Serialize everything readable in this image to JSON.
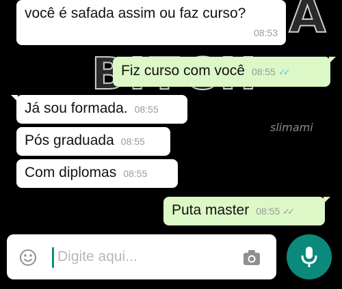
{
  "background": {
    "art_text_top": "MAFALA",
    "art_text_mid": "BITCH",
    "watermark": "slimami"
  },
  "messages": [
    {
      "side": "in",
      "text": "você é safada assim ou faz curso?",
      "time": "08:53"
    },
    {
      "side": "out",
      "text": "Fiz curso com você",
      "time": "08:55",
      "status": "read"
    },
    {
      "side": "in",
      "text": "Já sou formada.",
      "time": "08:55"
    },
    {
      "side": "in",
      "text": "Pós graduada",
      "time": "08:55"
    },
    {
      "side": "in",
      "text": "Com diplomas",
      "time": "08:55"
    },
    {
      "side": "out",
      "text": "Puta master",
      "time": "08:55",
      "status": "delivered"
    }
  ],
  "composer": {
    "placeholder": "Digite aqui...",
    "emoji_icon": "emoji-icon",
    "camera_icon": "camera-icon",
    "send_icon": "mic-icon"
  },
  "colors": {
    "incoming_bubble": "#ffffff",
    "outgoing_bubble": "#dcf8c6",
    "read_ticks": "#4fc3f7",
    "accent": "#0b8a7c"
  }
}
